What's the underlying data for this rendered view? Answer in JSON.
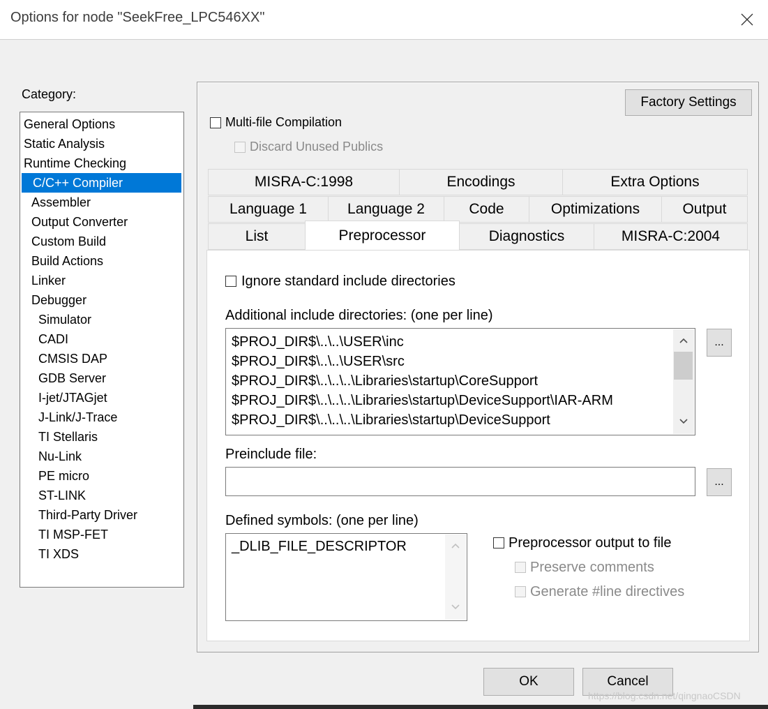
{
  "window": {
    "title": "Options for node \"SeekFree_LPC546XX\"",
    "close_glyph": "✕"
  },
  "category": {
    "label": "Category:",
    "items": [
      {
        "label": "General Options",
        "level": 0
      },
      {
        "label": "Static Analysis",
        "level": 0
      },
      {
        "label": "Runtime Checking",
        "level": 0
      },
      {
        "label": "C/C++ Compiler",
        "level": 1,
        "selected": true
      },
      {
        "label": "Assembler",
        "level": 1
      },
      {
        "label": "Output Converter",
        "level": 1
      },
      {
        "label": "Custom Build",
        "level": 1
      },
      {
        "label": "Build Actions",
        "level": 1
      },
      {
        "label": "Linker",
        "level": 1
      },
      {
        "label": "Debugger",
        "level": 1
      },
      {
        "label": "Simulator",
        "level": 2
      },
      {
        "label": "CADI",
        "level": 2
      },
      {
        "label": "CMSIS DAP",
        "level": 2
      },
      {
        "label": "GDB Server",
        "level": 2
      },
      {
        "label": "I-jet/JTAGjet",
        "level": 2
      },
      {
        "label": "J-Link/J-Trace",
        "level": 2
      },
      {
        "label": "TI Stellaris",
        "level": 2
      },
      {
        "label": "Nu-Link",
        "level": 2
      },
      {
        "label": "PE micro",
        "level": 2
      },
      {
        "label": "ST-LINK",
        "level": 2
      },
      {
        "label": "Third-Party Driver",
        "level": 2
      },
      {
        "label": "TI MSP-FET",
        "level": 2
      },
      {
        "label": "TI XDS",
        "level": 2
      }
    ]
  },
  "panel": {
    "factory_settings": "Factory Settings",
    "multi_file": "Multi-file Compilation",
    "discard_unused": "Discard Unused Publics"
  },
  "tabs": {
    "row1": [
      "MISRA-C:1998",
      "Encodings",
      "Extra Options"
    ],
    "row2": [
      "Language 1",
      "Language 2",
      "Code",
      "Optimizations",
      "Output"
    ],
    "row3": [
      "List",
      "Preprocessor",
      "Diagnostics",
      "MISRA-C:2004"
    ],
    "active": "Preprocessor"
  },
  "preprocessor": {
    "ignore_std": "Ignore standard include directories",
    "additional_label": "Additional include directories: (one per line)",
    "include_dirs": [
      "$PROJ_DIR$\\..\\..\\USER\\inc",
      "$PROJ_DIR$\\..\\..\\USER\\src",
      "$PROJ_DIR$\\..\\..\\..\\Libraries\\startup\\CoreSupport",
      "$PROJ_DIR$\\..\\..\\..\\Libraries\\startup\\DeviceSupport\\IAR-ARM",
      "$PROJ_DIR$\\..\\..\\..\\Libraries\\startup\\DeviceSupport"
    ],
    "browse_label": "...",
    "preinclude_label": "Preinclude file:",
    "preinclude_value": "",
    "defined_label": "Defined symbols: (one per line)",
    "defined_symbols": "_DLIB_FILE_DESCRIPTOR",
    "pp_output": "Preprocessor output to file",
    "preserve_comments": "Preserve comments",
    "generate_line": "Generate #line directives"
  },
  "buttons": {
    "ok": "OK",
    "cancel": "Cancel"
  },
  "watermark": "https://blog.csdn.net/qingnaoCSDN",
  "colors": {
    "selection": "#0078d7",
    "background": "#f0f0f0"
  }
}
